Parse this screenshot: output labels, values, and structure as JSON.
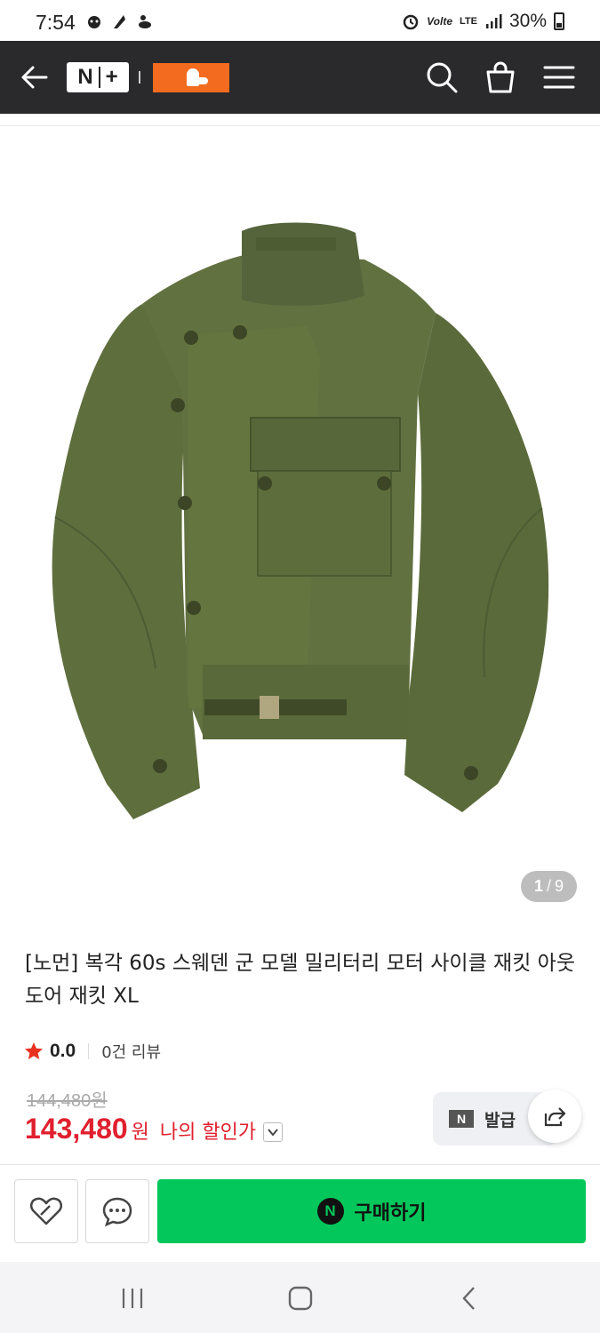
{
  "status_bar": {
    "time": "7:54",
    "volte": "Volte",
    "network": "LTE",
    "battery": "30%"
  },
  "header": {
    "logo_text": "N",
    "logo_plus": "+",
    "store_logo_name": "store-logo"
  },
  "gallery": {
    "current": "1",
    "separator": "/",
    "total": "9"
  },
  "product": {
    "title": "[노먼] 복각 60s 스웨덴 군 모델 밀리터리 모터 사이클 재킷 아웃도어 재킷 XL",
    "rating": "0.0",
    "reviews": "0건 리뷰",
    "original_price": "144,480원",
    "sale_price": "143,480",
    "price_unit": "원",
    "my_price_label": "나의 할인가"
  },
  "coupon": {
    "badge": "N",
    "label": "발급"
  },
  "actions": {
    "buy_badge": "N",
    "buy_label": "구매하기"
  },
  "colors": {
    "header_bg": "#2a2a2d",
    "accent_orange": "#f26b1f",
    "price_red": "#e0202e",
    "buy_green": "#03c75a",
    "jacket_olive": "#5b6a3a"
  }
}
